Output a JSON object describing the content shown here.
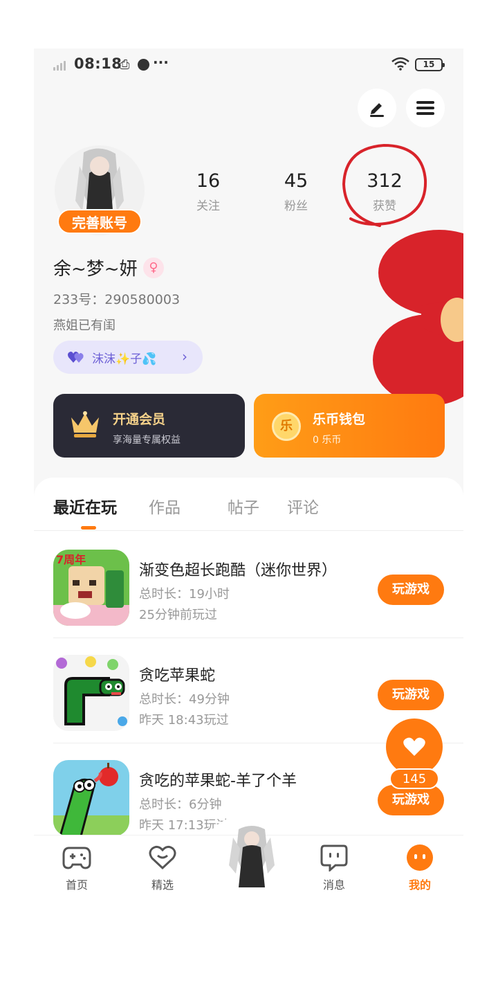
{
  "status_bar": {
    "time": "08:18",
    "battery": "15"
  },
  "header": {
    "edit_icon": "pen-icon",
    "menu_icon": "menu-icon"
  },
  "profile": {
    "complete_label": "完善账号",
    "stats": [
      {
        "num": "16",
        "label": "关注"
      },
      {
        "num": "45",
        "label": "粉丝"
      },
      {
        "num": "312",
        "label": "获赞"
      }
    ],
    "nickname": "余~梦~妍",
    "uid": "233号：290580003",
    "bio": "燕姐已有闺",
    "tag": "沫沫✨子💦"
  },
  "cards": {
    "vip": {
      "title": "开通会员",
      "sub": "享海量专属权益"
    },
    "coin": {
      "title": "乐币钱包",
      "sub": "0 乐币",
      "icon_text": "乐"
    }
  },
  "tabs": [
    "最近在玩",
    "作品",
    "帖子",
    "评论"
  ],
  "games": [
    {
      "name": "渐变色超长跑酷（迷你世界）",
      "duration": "总时长：19小时",
      "last": "25分钟前玩过",
      "button": "玩游戏",
      "badge": "7周年"
    },
    {
      "name": "贪吃苹果蛇",
      "duration": "总时长：49分钟",
      "last": "昨天 18:43玩过",
      "button": "玩游戏"
    },
    {
      "name": "贪吃的苹果蛇-羊了个羊",
      "duration": "总时长：6分钟",
      "last": "昨天 17:13玩过",
      "button": "玩游戏"
    }
  ],
  "like": {
    "count": "145"
  },
  "nav": [
    {
      "label": "首页",
      "icon": "gamepad-icon"
    },
    {
      "label": "精选",
      "icon": "heart-chat-icon"
    },
    {
      "label": "消息",
      "icon": "message-icon"
    },
    {
      "label": "我的",
      "icon": "smile-icon"
    }
  ],
  "colors": {
    "accent": "#ff7a10",
    "vip_card": "#2a2a36",
    "red_mark": "#d8232a"
  }
}
